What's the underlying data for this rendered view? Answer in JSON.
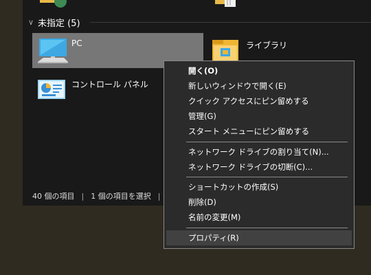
{
  "group": {
    "label": "未指定 (5)",
    "chevron": "chevron-down-icon"
  },
  "items": [
    {
      "label": "PC",
      "icon": "pc-icon"
    },
    {
      "label": "ライブラリ",
      "icon": "library-folder-icon"
    },
    {
      "label": "コントロール パネル",
      "icon": "control-panel-icon"
    }
  ],
  "statusbar": {
    "count": "40 個の項目",
    "selected": "1 個の項目を選択",
    "sep": "|"
  },
  "context_menu": {
    "items": [
      "開く(O)",
      "新しいウィンドウで開く(E)",
      "クイック アクセスにピン留めする",
      "管理(G)",
      "スタート メニューにピン留めする",
      "ネットワーク ドライブの割り当て(N)...",
      "ネットワーク ドライブの切断(C)...",
      "ショートカットの作成(S)",
      "削除(D)",
      "名前の変更(M)",
      "プロパティ(R)"
    ]
  },
  "colors": {
    "background": "#302b20",
    "window": "#191919",
    "selection": "#777777",
    "menu": "#2b2b2b",
    "menu_hover": "#414141"
  }
}
